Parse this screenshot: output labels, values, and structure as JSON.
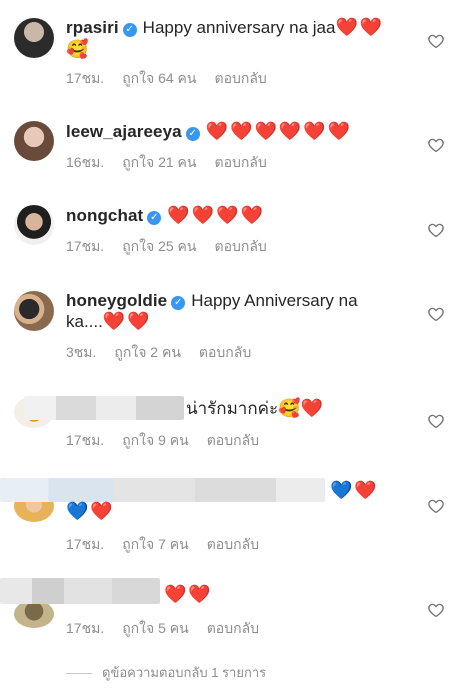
{
  "comments": [
    {
      "username": "rpasiri",
      "text": "Happy anniversary na jaa",
      "hearts": "❤️❤️",
      "extra": "🥰",
      "time": "17ชม.",
      "likes": "ถูกใจ 64 คน",
      "reply": "ตอบกลับ"
    },
    {
      "username": "leew_ajareeya",
      "hearts": "❤️❤️❤️❤️❤️❤️",
      "time": "16ชม.",
      "likes": "ถูกใจ 21 คน",
      "reply": "ตอบกลับ"
    },
    {
      "username": "nongchat",
      "hearts": "❤️❤️❤️❤️",
      "time": "17ชม.",
      "likes": "ถูกใจ 25 คน",
      "reply": "ตอบกลับ"
    },
    {
      "username": "honeygoldie",
      "text": "Happy Anniversary na",
      "text2": "ka....",
      "hearts": "❤️❤️",
      "time": "3ชม.",
      "likes": "ถูกใจ 2 คน",
      "reply": "ตอบกลับ"
    },
    {
      "text": "น่ารักมากค่ะ",
      "extra": "🥰",
      "hearts": "❤️",
      "time": "17ชม.",
      "likes": "ถูกใจ 9 คน",
      "reply": "ตอบกลับ"
    },
    {
      "blue_hearts": "💙",
      "hearts": "❤️",
      "blue_hearts2": "💙",
      "hearts2": "❤️",
      "time": "17ชม.",
      "likes": "ถูกใจ 7 คน",
      "reply": "ตอบกลับ"
    },
    {
      "hearts": "❤️❤️",
      "time": "17ชม.",
      "likes": "ถูกใจ 5 คน",
      "reply": "ตอบกลับ"
    }
  ],
  "view_replies": "ดูข้อความตอบกลับ 1 รายการ",
  "colors": {
    "verified": "#3897f0",
    "heart": "#e0245e",
    "meta": "#8e8e8e"
  }
}
